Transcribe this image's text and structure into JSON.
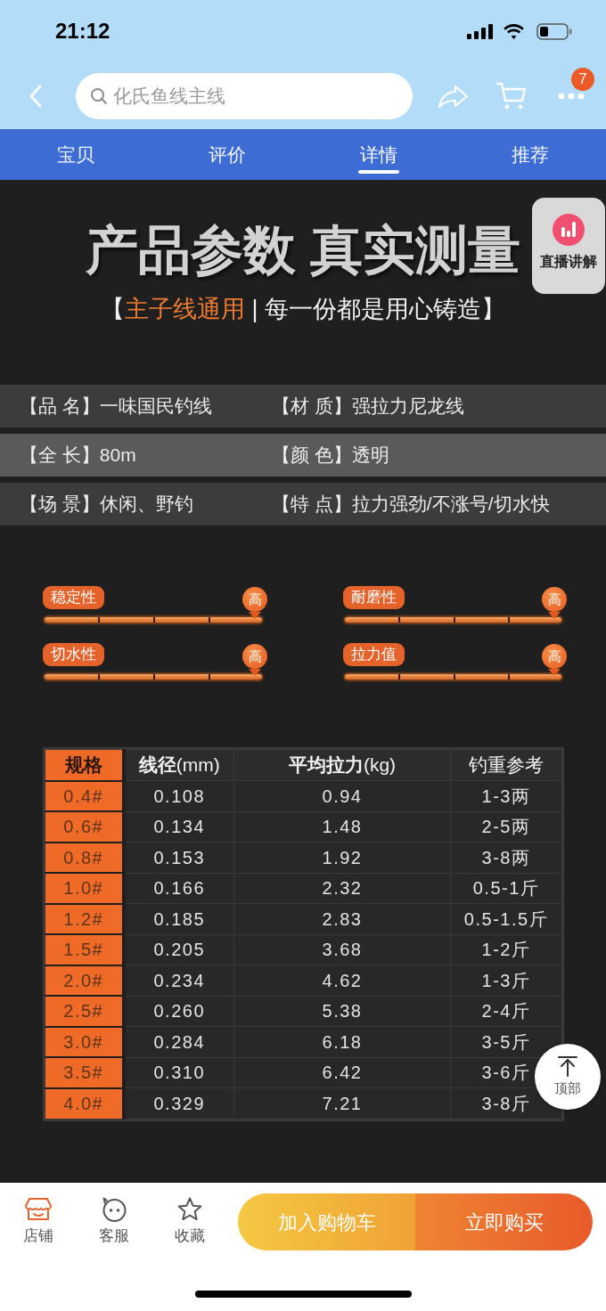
{
  "status_bar": {
    "time": "21:12"
  },
  "nav_bar": {
    "search": {
      "placeholder": "化氏鱼线主线"
    },
    "badge": "7"
  },
  "tabs": [
    {
      "label": "宝贝",
      "selected": false
    },
    {
      "label": "评价",
      "selected": false
    },
    {
      "label": "详情",
      "selected": true
    },
    {
      "label": "推荐",
      "selected": false
    }
  ],
  "detail": {
    "heading": "产品参数 真实测量",
    "subtitle": [
      {
        "text": "【",
        "highlight": false
      },
      {
        "text": "主子线通用",
        "highlight": true
      },
      {
        "text": " | 每一份都是用心铸造】",
        "highlight": false
      }
    ],
    "params": [
      {
        "highlighted": false,
        "items": [
          {
            "label": "【品 名】",
            "value": "一味国民钓线"
          },
          {
            "label": "【材 质】",
            "value": "强拉力尼龙线"
          }
        ]
      },
      {
        "highlighted": true,
        "items": [
          {
            "label": "【全 长】",
            "value": "80m"
          },
          {
            "label": "【颜 色】",
            "value": "透明"
          }
        ]
      },
      {
        "highlighted": false,
        "items": [
          {
            "label": "【场 景】",
            "value": "休闲、野钓"
          },
          {
            "label": "【特 点】",
            "value": "拉力强劲/不涨号/切水快"
          }
        ]
      }
    ],
    "ratings": [
      {
        "label": "稳定性",
        "marker": "高",
        "level": 1
      },
      {
        "label": "耐磨性",
        "marker": "高",
        "level": 1
      },
      {
        "label": "切水性",
        "marker": "高",
        "level": 1
      },
      {
        "label": "拉力值",
        "marker": "高",
        "level": 1
      }
    ],
    "table": {
      "columns": [
        "规格",
        "**线径**(mm)",
        "**平均拉力**(kg)",
        "钓重参考"
      ],
      "rows": [
        [
          "0.4#",
          "0.108",
          "0.94",
          "1-3两"
        ],
        [
          "0.6#",
          "0.134",
          "1.48",
          "2-5两"
        ],
        [
          "0.8#",
          "0.153",
          "1.92",
          "3-8两"
        ],
        [
          "1.0#",
          "0.166",
          "2.32",
          "0.5-1斤"
        ],
        [
          "1.2#",
          "0.185",
          "2.83",
          "0.5-1.5斤"
        ],
        [
          "1.5#",
          "0.205",
          "3.68",
          "1-2斤"
        ],
        [
          "2.0#",
          "0.234",
          "4.62",
          "1-3斤"
        ],
        [
          "2.5#",
          "0.260",
          "5.38",
          "2-4斤"
        ],
        [
          "3.0#",
          "0.284",
          "6.18",
          "3-5斤"
        ],
        [
          "3.5#",
          "0.310",
          "6.42",
          "3-6斤"
        ],
        [
          "4.0#",
          "0.329",
          "7.21",
          "3-8斤"
        ]
      ]
    }
  },
  "floating": {
    "live": "直播讲解",
    "to_top": "顶部"
  },
  "bottom_bar": {
    "items": [
      {
        "kind": "store",
        "label": "店铺"
      },
      {
        "kind": "service",
        "label": "客服"
      },
      {
        "kind": "favorite",
        "label": "收藏"
      }
    ],
    "buttons": [
      "加入购物车",
      "立即购买"
    ]
  }
}
